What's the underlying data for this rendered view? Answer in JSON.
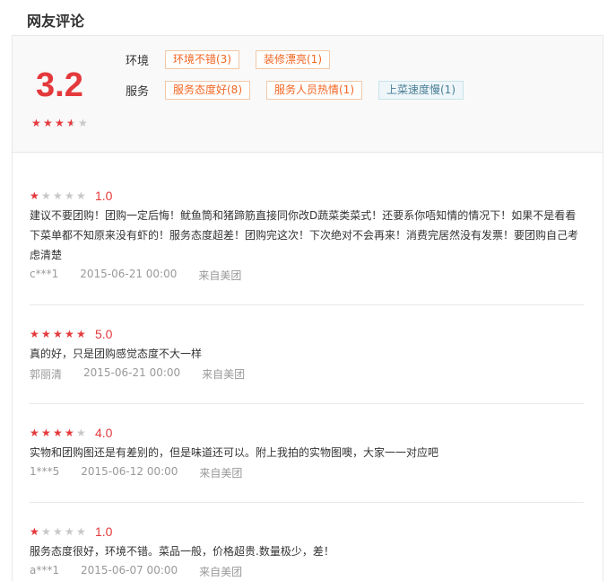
{
  "section_title": "网友评论",
  "summary": {
    "score": "3.2",
    "stars": {
      "full": 3,
      "half": 1,
      "empty": 1
    },
    "groups": [
      {
        "category": "环境",
        "tags": [
          {
            "label": "环境不错(3)",
            "style": "positive"
          },
          {
            "label": "装修漂亮(1)",
            "style": "positive"
          }
        ]
      },
      {
        "category": "服务",
        "tags": [
          {
            "label": "服务态度好(8)",
            "style": "positive"
          },
          {
            "label": "服务人员热情(1)",
            "style": "positive"
          },
          {
            "label": "上菜速度慢(1)",
            "style": "neutral"
          }
        ]
      }
    ]
  },
  "reviews": [
    {
      "stars": 1,
      "rating": "1.0",
      "text": "建议不要团购！团购一定后悔！鱿鱼筒和猪蹄筋直接同你改D蔬菜类菜式！还要系你唔知情的情况下！如果不是看看下菜单都不知原来没有虾的！服务态度超差！团购完这次！下次绝对不会再来！消费完居然没有发票！要团购自己考虑清楚",
      "user": "c***1",
      "time": "2015-06-21 00:00",
      "source": "来自美团"
    },
    {
      "stars": 5,
      "rating": "5.0",
      "text": "真的好，只是团购感觉态度不大一样",
      "user": "郭丽清",
      "time": "2015-06-21 00:00",
      "source": "来自美团"
    },
    {
      "stars": 4,
      "rating": "4.0",
      "text": "实物和团购图还是有差别的，但是味道还可以。附上我拍的实物图噢，大家一一对应吧",
      "user": "1***5",
      "time": "2015-06-12 00:00",
      "source": "来自美团"
    },
    {
      "stars": 1,
      "rating": "1.0",
      "text": "服务态度很好，环境不错。菜品一般，价格超贵.数量极少，差！",
      "user": "a***1",
      "time": "2015-06-07 00:00",
      "source": "来自美团"
    }
  ],
  "colors": {
    "accent": "#e4393c",
    "tag_text": "#f26522",
    "tag_neutral": "#4a7e96"
  }
}
